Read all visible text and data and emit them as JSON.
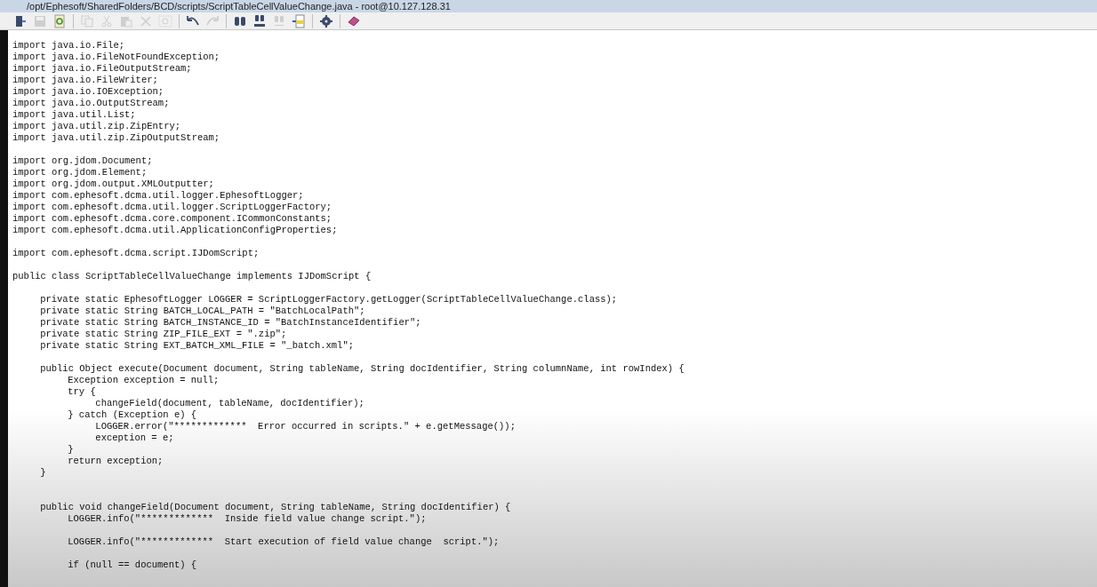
{
  "window": {
    "title": "/opt/Ephesoft/SharedFolders/BCD/scripts/ScriptTableCellValueChange.java - root@10.127.128.31"
  },
  "toolbar": [
    {
      "kind": "exit",
      "disabled": false
    },
    {
      "kind": "save",
      "disabled": true
    },
    {
      "kind": "reload",
      "disabled": false
    },
    {
      "kind": "separator"
    },
    {
      "kind": "copy",
      "disabled": true
    },
    {
      "kind": "cut",
      "disabled": true
    },
    {
      "kind": "paste",
      "disabled": true
    },
    {
      "kind": "delete",
      "disabled": true
    },
    {
      "kind": "selectall",
      "disabled": true
    },
    {
      "kind": "separator"
    },
    {
      "kind": "undo",
      "disabled": false
    },
    {
      "kind": "redo",
      "disabled": true
    },
    {
      "kind": "separator"
    },
    {
      "kind": "find",
      "disabled": false
    },
    {
      "kind": "replace",
      "disabled": false
    },
    {
      "kind": "findnext",
      "disabled": true
    },
    {
      "kind": "gotoline",
      "disabled": false
    },
    {
      "kind": "separator"
    },
    {
      "kind": "settings",
      "disabled": false
    },
    {
      "kind": "separator"
    },
    {
      "kind": "help",
      "disabled": false
    }
  ],
  "code": "import java.io.File;\nimport java.io.FileNotFoundException;\nimport java.io.FileOutputStream;\nimport java.io.FileWriter;\nimport java.io.IOException;\nimport java.io.OutputStream;\nimport java.util.List;\nimport java.util.zip.ZipEntry;\nimport java.util.zip.ZipOutputStream;\n\nimport org.jdom.Document;\nimport org.jdom.Element;\nimport org.jdom.output.XMLOutputter;\nimport com.ephesoft.dcma.util.logger.EphesoftLogger;\nimport com.ephesoft.dcma.util.logger.ScriptLoggerFactory;\nimport com.ephesoft.dcma.core.component.ICommonConstants;\nimport com.ephesoft.dcma.util.ApplicationConfigProperties;\n\nimport com.ephesoft.dcma.script.IJDomScript;\n\npublic class ScriptTableCellValueChange implements IJDomScript {\n\n\tprivate static EphesoftLogger LOGGER = ScriptLoggerFactory.getLogger(ScriptTableCellValueChange.class);\n\tprivate static String BATCH_LOCAL_PATH = \"BatchLocalPath\";\n\tprivate static String BATCH_INSTANCE_ID = \"BatchInstanceIdentifier\";\n\tprivate static String ZIP_FILE_EXT = \".zip\";\n\tprivate static String EXT_BATCH_XML_FILE = \"_batch.xml\";\n\n\tpublic Object execute(Document document, String tableName, String docIdentifier, String columnName, int rowIndex) {\n\t\tException exception = null;\n\t\ttry {\n\t\t\tchangeField(document, tableName, docIdentifier);\n\t\t} catch (Exception e) {\n\t\t\tLOGGER.error(\"*************  Error occurred in scripts.\" + e.getMessage());\n\t\t\texception = e;\n\t\t}\n\t\treturn exception;\n\t}\n\n\n\tpublic void changeField(Document document, String tableName, String docIdentifier) {\n\t\tLOGGER.info(\"*************  Inside field value change script.\");\n\n\t\tLOGGER.info(\"*************  Start execution of field value change  script.\");\n\n\t\tif (null == document) {"
}
